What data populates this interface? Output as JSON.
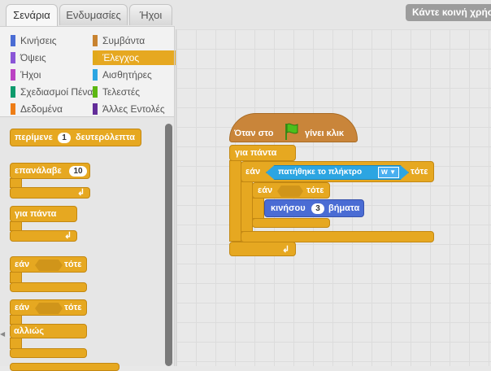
{
  "tabs": [
    "Σενάρια",
    "Ενδυμασίες",
    "Ήχοι"
  ],
  "share_button": "Κάντε κοινή χρήση",
  "categories": [
    {
      "label": "Κινήσεις",
      "color": "#4a6cd4"
    },
    {
      "label": "Συμβάντα",
      "color": "#c88330"
    },
    {
      "label": "Όψεις",
      "color": "#8a55d7"
    },
    {
      "label": "Έλεγχος",
      "color": "#e1a91a"
    },
    {
      "label": "Ήχοι",
      "color": "#bb42c3"
    },
    {
      "label": "Αισθητήρες",
      "color": "#2ca5e2"
    },
    {
      "label": "Σχεδιασμοί Πένας",
      "color": "#0e9a6c"
    },
    {
      "label": "Τελεστές",
      "color": "#5cb712"
    },
    {
      "label": "Δεδομένα",
      "color": "#ee7d16"
    },
    {
      "label": "Άλλες Εντολές",
      "color": "#632d99"
    }
  ],
  "palette": {
    "wait_label": "περίμενε",
    "wait_value": "1",
    "wait_unit": "δευτερόλεπτα",
    "repeat_label": "επανάλαβε",
    "repeat_value": "10",
    "forever_label": "για πάντα",
    "if_label": "εάν",
    "then_label": "τότε",
    "else_label": "αλλιώς"
  },
  "script": {
    "hat_label": "Όταν στο",
    "hat_suffix": "γίνει κλικ",
    "forever_label": "για πάντα",
    "if_label": "εάν",
    "then_label": "τότε",
    "sensor_label": "πατήθηκε το πλήκτρο",
    "key_value": "w",
    "move_label": "κινήσου",
    "move_value": "3",
    "move_unit": "βήματα"
  }
}
